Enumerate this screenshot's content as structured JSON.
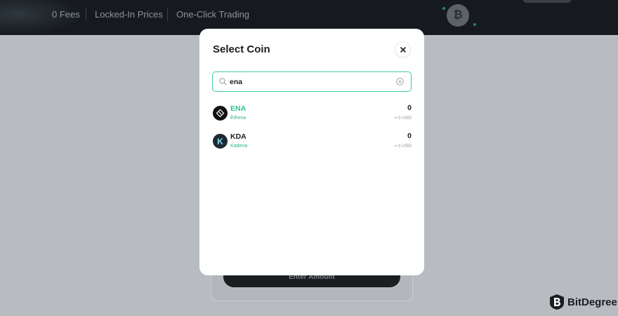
{
  "header": {
    "features": [
      "0 Fees",
      "Locked-In Prices",
      "One-Click Trading"
    ],
    "coin_glyph": "₿"
  },
  "background": {
    "cta_label": "Enter Amount"
  },
  "modal": {
    "title": "Select Coin",
    "search": {
      "value": "ena"
    },
    "coins": [
      {
        "symbol": "ENA",
        "name": "Ethena",
        "balance": "0",
        "usd": "≈ 0 USD",
        "highlighted": true,
        "logo_glyph": ""
      },
      {
        "symbol": "KDA",
        "name": "Kadena",
        "balance": "0",
        "usd": "≈ 0 USD",
        "highlighted": false,
        "logo_glyph": "K"
      }
    ]
  },
  "watermark": {
    "label": "BitDegree"
  },
  "colors": {
    "accent": "#2cc48b",
    "search_border": "#3fcf9a",
    "overlay": "#b8bcc1",
    "header_bg": "#161a1e"
  }
}
